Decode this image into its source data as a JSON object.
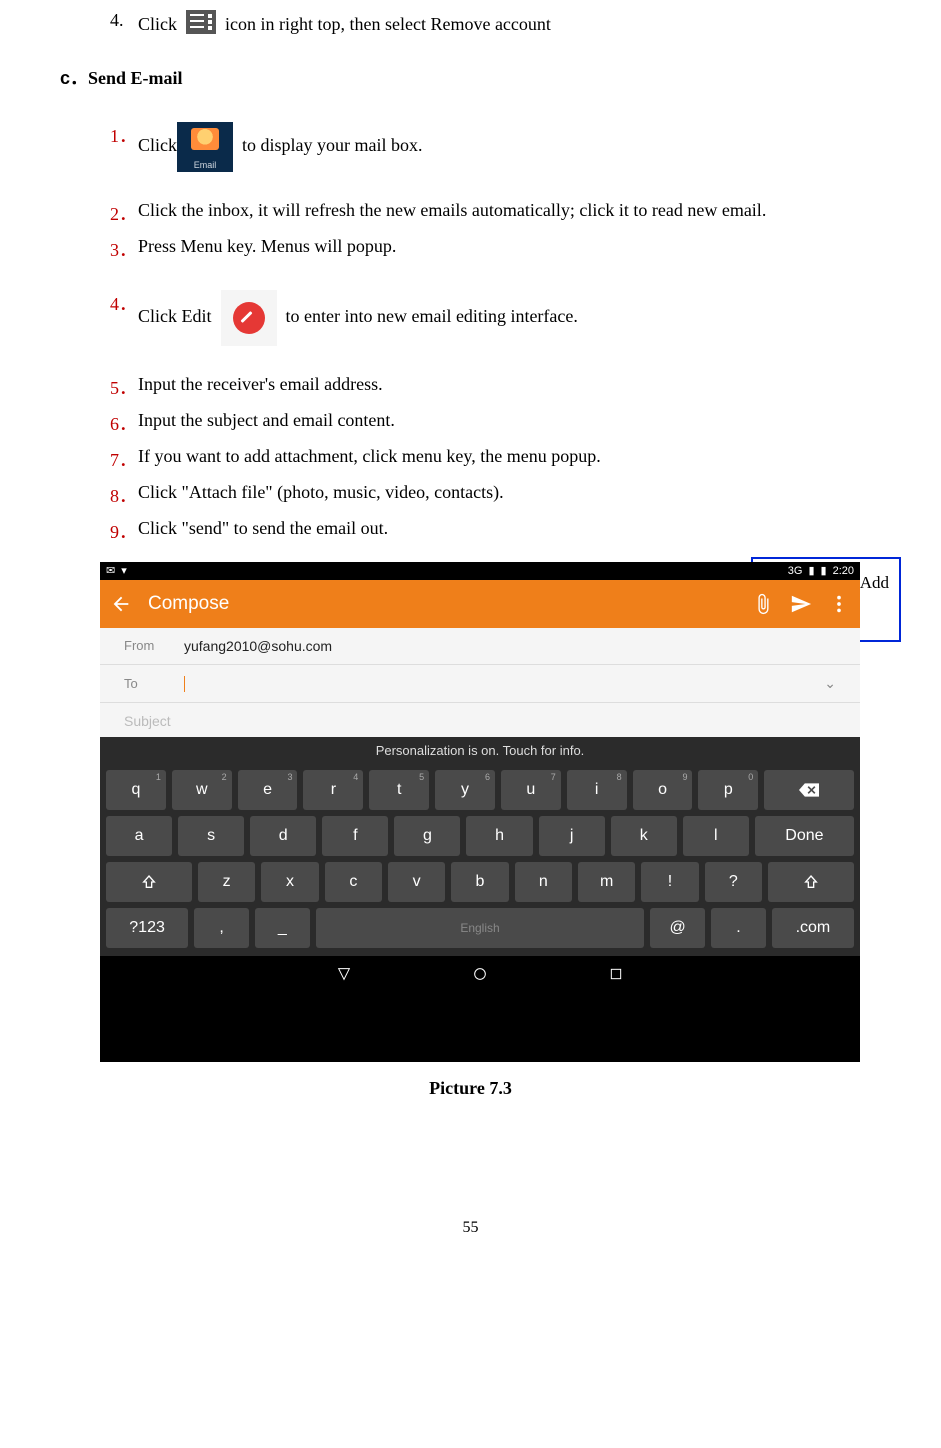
{
  "section_b_item4_num": "4.",
  "section_b_item4_pre": "Click",
  "section_b_item4_post": "icon in right top, then select Remove account",
  "section_c_marker": "c．",
  "section_c_title": "Send E-mail",
  "c_items": {
    "1": {
      "num": "1．",
      "pre": "Click",
      "post": "to display your mail box."
    },
    "2": {
      "num": "2．",
      "text": "Click the inbox, it will refresh the new emails automatically; click it to read new email."
    },
    "3": {
      "num": "3．",
      "text": "Press Menu key. Menus will popup."
    },
    "4": {
      "num": "4．",
      "pre": "Click Edit",
      "post": "to enter into new email editing interface."
    },
    "5": {
      "num": "5．",
      "text": "Input the receiver's email address."
    },
    "6": {
      "num": "6．",
      "text": "Input the subject and email content."
    },
    "7": {
      "num": "7．",
      "text": "If you want to add attachment, click menu key, the menu popup."
    },
    "8": {
      "num": "8．",
      "text": "Click \"Attach file\" (photo, music, video, contacts)."
    },
    "9": {
      "num": "9．",
      "text": "Click \"send\" to send the email out."
    }
  },
  "callout_text": "Click it and Add attachment",
  "screenshot": {
    "status_net": "3G",
    "status_time": "2:20",
    "appbar_title": "Compose",
    "from_label": "From",
    "from_value": "yufang2010@sohu.com",
    "to_label": "To",
    "subject_placeholder": "Subject",
    "kb_info": "Personalization is on. Touch for info.",
    "row1": [
      "q",
      "w",
      "e",
      "r",
      "t",
      "y",
      "u",
      "i",
      "o",
      "p"
    ],
    "row1_hints": [
      "1",
      "2",
      "3",
      "4",
      "5",
      "6",
      "7",
      "8",
      "9",
      "0"
    ],
    "row2": [
      "a",
      "s",
      "d",
      "f",
      "g",
      "h",
      "j",
      "k",
      "l"
    ],
    "row2_done": "Done",
    "row3": [
      "z",
      "x",
      "c",
      "v",
      "b",
      "n",
      "m",
      "!",
      "?"
    ],
    "row4_sym": "?123",
    "row4_comma": ",",
    "row4_underscore": "_",
    "row4_space": "English",
    "row4_at": "@",
    "row4_dot": ".",
    "row4_com": ".com"
  },
  "caption": "Picture 7.3",
  "page_number": "55"
}
